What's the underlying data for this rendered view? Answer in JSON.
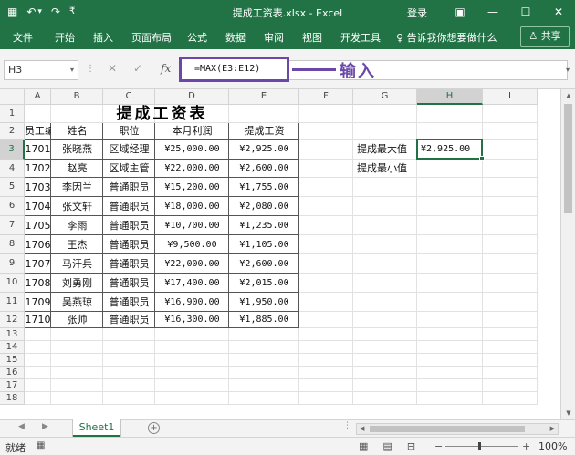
{
  "window": {
    "title": "提成工资表.xlsx - Excel",
    "login": "登录",
    "qat": {
      "save_icon": "▦",
      "undo_icon": "↶",
      "undo_dd": "▾",
      "redo_icon": "↷",
      "customize": "₹"
    },
    "controls": {
      "ribbon_display": "▣",
      "minimize": "—",
      "maximize": "☐",
      "close": "✕"
    }
  },
  "ribbon": {
    "tabs": [
      "文件",
      "开始",
      "插入",
      "页面布局",
      "公式",
      "数据",
      "审阅",
      "视图",
      "开发工具"
    ],
    "tell_me": "告诉我你想要做什么",
    "share": "共享",
    "tellme_icon": "♀",
    "share_icon": "♙"
  },
  "formula_bar": {
    "name_box": "H3",
    "name_dd": "▾",
    "sep": "⋮",
    "cancel_icon": "✕",
    "enter_icon": "✓",
    "fx_icon": "fx",
    "formula": "=MAX(E3:E12)",
    "dd": "▾",
    "annotation": "输入"
  },
  "columns": [
    "A",
    "B",
    "C",
    "D",
    "E",
    "F",
    "G",
    "H",
    "I"
  ],
  "rows": [
    "1",
    "2",
    "3",
    "4",
    "5",
    "6",
    "7",
    "8",
    "9",
    "10",
    "11",
    "12",
    "13",
    "14",
    "15",
    "16",
    "17",
    "18"
  ],
  "sheet": {
    "title": "提成工资表",
    "headers": [
      "员工编号",
      "姓名",
      "职位",
      "本月利润",
      "提成工资"
    ],
    "data": [
      [
        "1701",
        "张晓燕",
        "区域经理",
        "¥25,000.00",
        "¥2,925.00"
      ],
      [
        "1702",
        "赵亮",
        "区域主管",
        "¥22,000.00",
        "¥2,600.00"
      ],
      [
        "1703",
        "李因兰",
        "普通职员",
        "¥15,200.00",
        "¥1,755.00"
      ],
      [
        "1704",
        "张文轩",
        "普通职员",
        "¥18,000.00",
        "¥2,080.00"
      ],
      [
        "1705",
        "李雨",
        "普通职员",
        "¥10,700.00",
        "¥1,235.00"
      ],
      [
        "1706",
        "王杰",
        "普通职员",
        "¥9,500.00",
        "¥1,105.00"
      ],
      [
        "1707",
        "马汗兵",
        "普通职员",
        "¥22,000.00",
        "¥2,600.00"
      ],
      [
        "1708",
        "刘勇刚",
        "普通职员",
        "¥17,400.00",
        "¥2,015.00"
      ],
      [
        "1709",
        "吴燕琼",
        "普通职员",
        "¥16,900.00",
        "¥1,950.00"
      ],
      [
        "1710",
        "张帅",
        "普通职员",
        "¥16,300.00",
        "¥1,885.00"
      ]
    ],
    "side_labels": [
      "提成最大值",
      "提成最小值"
    ],
    "h3_value": "¥2,925.00"
  },
  "sheet_tabs": {
    "active": "Sheet1",
    "prev": "◀",
    "next": "▶",
    "add": "+",
    "more": "⋮"
  },
  "hscroll": {
    "left": "◀",
    "right": "▶"
  },
  "vscroll": {
    "up": "▲",
    "down": "▼"
  },
  "status": {
    "ready": "就绪",
    "macro_icon": "▦",
    "view_normal": "▦",
    "view_layout": "▤",
    "view_break": "⊟",
    "zoom_out": "−",
    "zoom_in": "+",
    "zoom": "100%"
  },
  "colors": {
    "excel_green": "#217346",
    "annotation": "#6b48a8"
  }
}
